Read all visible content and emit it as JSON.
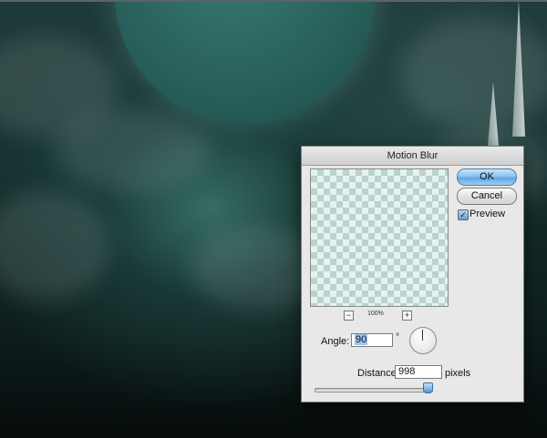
{
  "dialog": {
    "title": "Motion Blur",
    "ok_label": "OK",
    "cancel_label": "Cancel",
    "preview_label": "Preview",
    "preview_checked": true,
    "zoom_level": "100%",
    "zoom_minus": "−",
    "zoom_plus": "+",
    "angle_label": "Angle:",
    "angle_value": "90",
    "angle_unit": "°",
    "distance_label": "Distance:",
    "distance_value": "998",
    "distance_unit": "pixels",
    "distance_slider_fraction": 0.998
  },
  "icons": {
    "check": "✓"
  },
  "colors": {
    "ok_accent": "#5fa6e2",
    "selection": "#9ec6ef"
  }
}
